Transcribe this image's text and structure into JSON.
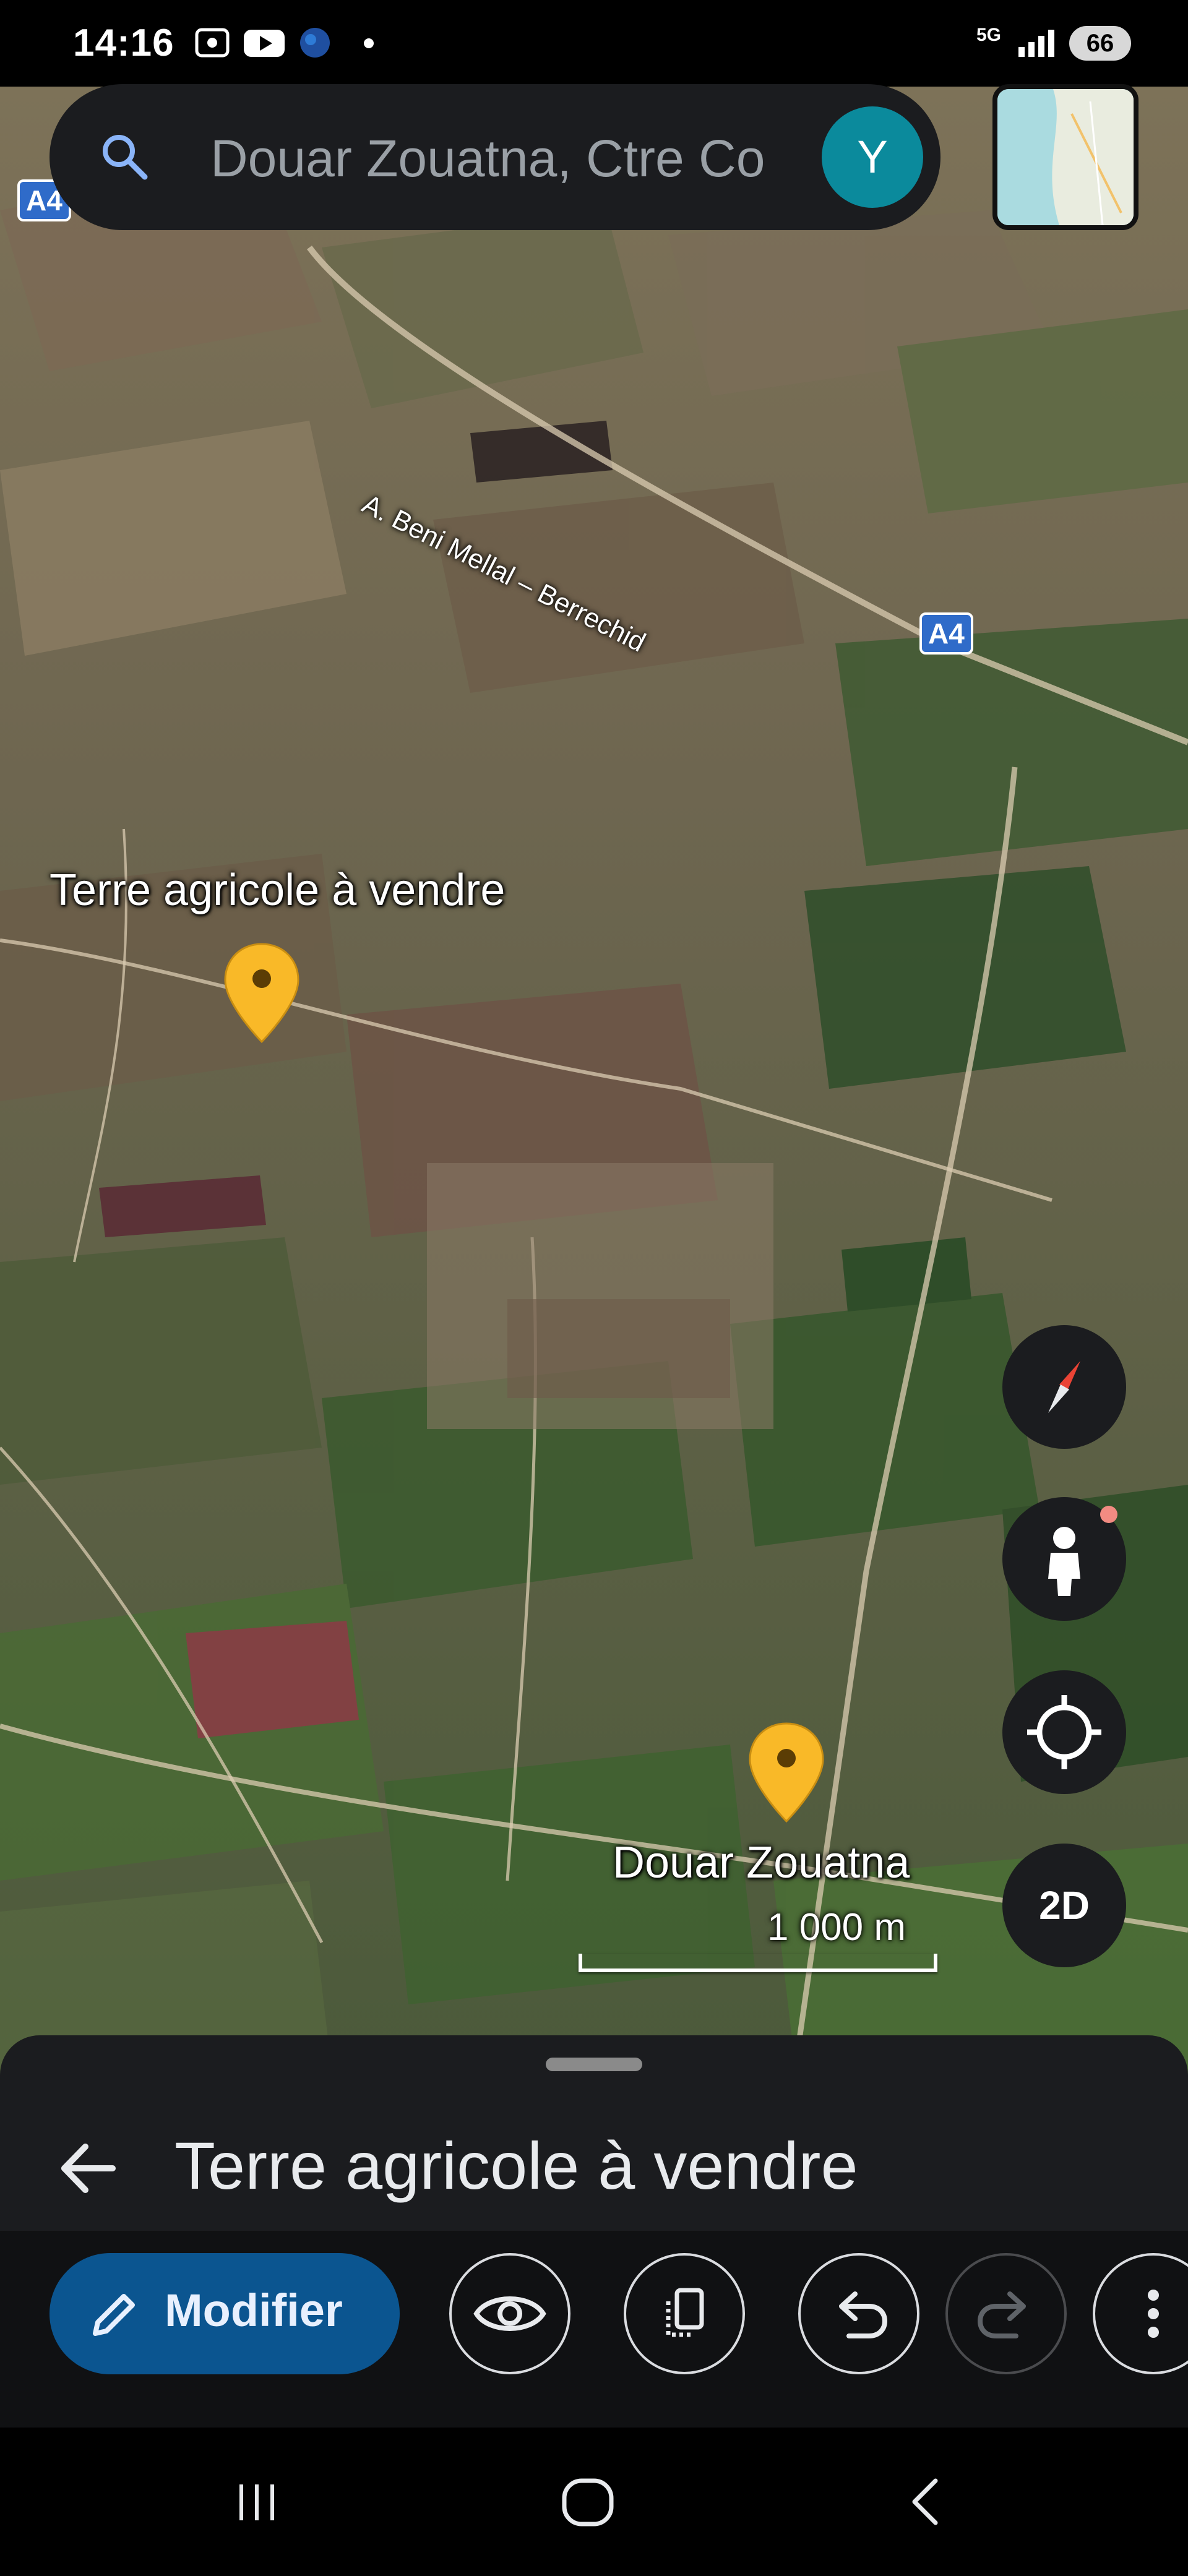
{
  "status_bar": {
    "time": "14:16",
    "icons": [
      "screen-record-icon",
      "youtube-icon",
      "browser-icon",
      "notification-dot"
    ],
    "network": "5G",
    "battery": "66"
  },
  "search": {
    "query": "Douar Zouatna, Ctre Co",
    "avatar_letter": "Y"
  },
  "map": {
    "road_shield": "A4",
    "road_label": "A. Beni Mellal – Berrechid",
    "places": [
      {
        "label": "Terre agricole à vendre"
      },
      {
        "label": "Douar Zouatna"
      }
    ],
    "scale": "1 000 m",
    "pin_color": "#F9B928"
  },
  "controls": {
    "view_mode": "2D"
  },
  "bottom_sheet": {
    "title": "Terre agricole à vendre",
    "edit_label": "Modifier",
    "buttons": [
      "eye-icon",
      "copy-icon",
      "undo-icon",
      "redo-icon",
      "more-vert-icon"
    ]
  },
  "colors": {
    "accent": "#0B5590",
    "avatar": "#0B8A9C",
    "sheet": "#1B1C1F"
  }
}
